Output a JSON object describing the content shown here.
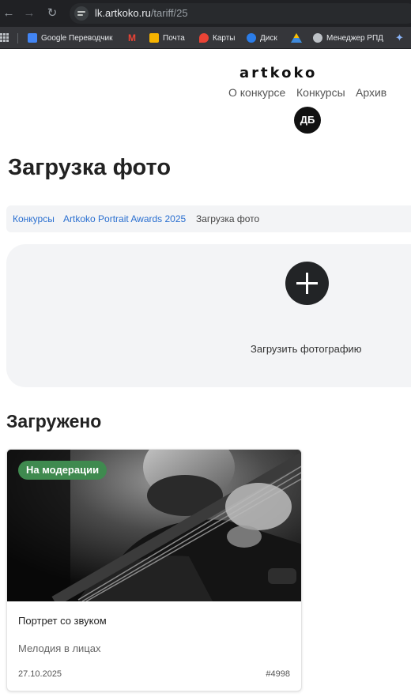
{
  "browser": {
    "url_host": "lk.artkoko.ru",
    "url_path": "/tariff/25",
    "bookmarks": [
      {
        "label": "Google Переводчик",
        "icon": "google-translate-icon",
        "color": "#4285f4"
      },
      {
        "label": "",
        "icon": "gmail-icon",
        "color": "#ea4335"
      },
      {
        "label": "Почта",
        "icon": "mail-icon",
        "color": "#f6b300"
      },
      {
        "label": "Карты",
        "icon": "maps-icon",
        "color": "#ea4335"
      },
      {
        "label": "Диск",
        "icon": "disk-icon",
        "color": "#2b7de9"
      },
      {
        "label": "",
        "icon": "drive-icon",
        "color": "#34a853"
      },
      {
        "label": "Менеджер РПД",
        "icon": "globe-icon",
        "color": "#bdc1c6"
      },
      {
        "label": "",
        "icon": "gemini-icon",
        "color": "#8ab4f8"
      }
    ]
  },
  "header": {
    "logo": "artkoko",
    "nav": [
      "О конкурсе",
      "Конкурсы",
      "Архив"
    ],
    "avatar_initials": "ДБ"
  },
  "page": {
    "title": "Загрузка фото",
    "breadcrumb": [
      "Конкурсы",
      "Artkoko Portrait Awards 2025",
      "Загрузка фото"
    ],
    "upload_label": "Загрузить фотографию",
    "uploaded_title": "Загружено"
  },
  "card": {
    "status": "На модерации",
    "title": "Портрет со звуком",
    "nomination": "Мелодия в лицах",
    "date": "27.10.2025",
    "id": "#4998"
  },
  "colors": {
    "badge": "#3f8a4f",
    "link": "#2a6fd0",
    "panel": "#f3f4f6"
  }
}
